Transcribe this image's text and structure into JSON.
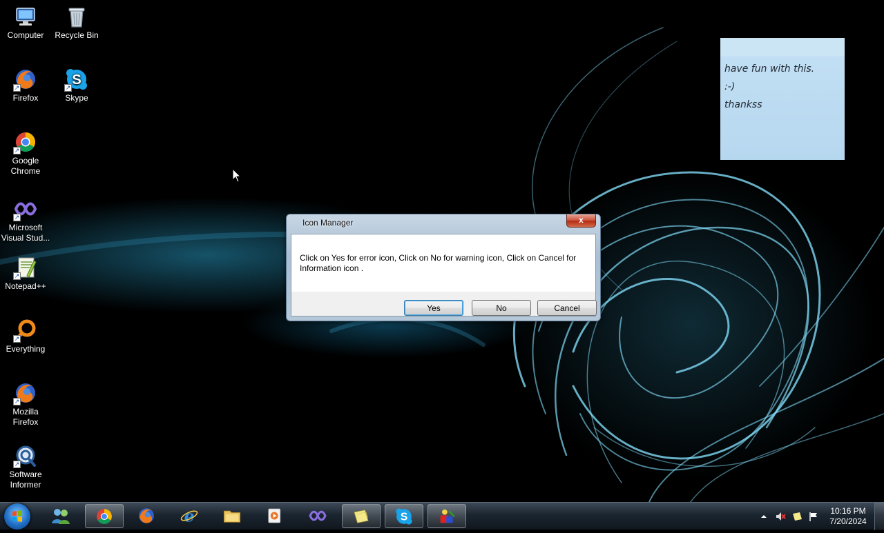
{
  "desktop_icons": [
    {
      "label": "Computer",
      "icon": "computer-icon"
    },
    {
      "label": "Recycle Bin",
      "icon": "recycle-bin-icon"
    },
    {
      "label": "Firefox",
      "icon": "firefox-icon"
    },
    {
      "label": "Skype",
      "icon": "skype-icon"
    },
    {
      "label": "Google Chrome",
      "icon": "chrome-icon"
    },
    {
      "label": "Microsoft Visual Stud...",
      "icon": "visual-studio-icon"
    },
    {
      "label": "Notepad++",
      "icon": "notepadpp-icon"
    },
    {
      "label": "Everything",
      "icon": "everything-icon"
    },
    {
      "label": "Mozilla Firefox",
      "icon": "firefox-icon"
    },
    {
      "label": "Software Informer",
      "icon": "software-informer-icon"
    }
  ],
  "sticky_note": {
    "lines": [
      "have fun with this.",
      ":-)",
      "thankss"
    ]
  },
  "dialog": {
    "title": "Icon Manager",
    "close_label": "x",
    "message": "Click on Yes for error icon, Click on No for warning icon, Click on Cancel for Information icon .",
    "buttons": {
      "yes": "Yes",
      "no": "No",
      "cancel": "Cancel"
    }
  },
  "taskbar": {
    "items": [
      {
        "icon": "people-icon",
        "open": false
      },
      {
        "icon": "chrome-icon",
        "open": true
      },
      {
        "icon": "firefox-icon",
        "open": false
      },
      {
        "icon": "internet-explorer-icon",
        "open": false
      },
      {
        "icon": "folder-icon",
        "open": false
      },
      {
        "icon": "media-player-icon",
        "open": false
      },
      {
        "icon": "visual-studio-icon",
        "open": false
      },
      {
        "icon": "sticky-notes-icon",
        "open": true
      },
      {
        "icon": "skype-icon",
        "open": true
      },
      {
        "icon": "icon-manager-app-icon",
        "open": true
      }
    ],
    "clock": {
      "time": "10:16 PM",
      "date": "7/20/2024"
    }
  },
  "colors": {
    "accent_glow": "#5ec8ee",
    "sticky_bg": "#c1def4",
    "close_button": "#c8503a"
  }
}
